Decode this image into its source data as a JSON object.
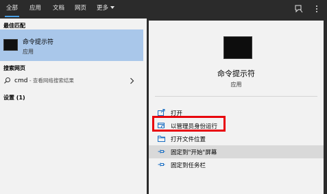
{
  "tabs": [
    {
      "label": "全部",
      "active": true
    },
    {
      "label": "应用",
      "active": false
    },
    {
      "label": "文档",
      "active": false
    },
    {
      "label": "网页",
      "active": false
    },
    {
      "label": "更多",
      "active": false
    }
  ],
  "top_icons": [
    "feedback-icon",
    "more-options-icon"
  ],
  "left": {
    "best_match_heading": "最佳匹配",
    "best_match": {
      "name": "命令提示符",
      "type": "应用",
      "icon": "cmd-icon"
    },
    "web_heading": "搜索网页",
    "web_result": {
      "query": "cmd",
      "hint": " - 查看网络搜索结果"
    },
    "settings_heading": "设置 (1)"
  },
  "right": {
    "app_name": "命令提示符",
    "app_type": "应用",
    "actions": [
      {
        "label": "打开",
        "icon": "open-icon"
      },
      {
        "label": "以管理员身份运行",
        "icon": "run-as-admin-icon"
      },
      {
        "label": "打开文件位置",
        "icon": "folder-icon"
      },
      {
        "label": "固定到\"开始\"屏幕",
        "icon": "pin-icon"
      },
      {
        "label": "固定到任务栏",
        "icon": "pin-icon"
      }
    ]
  },
  "colors": {
    "accent": "#4aa0e6",
    "highlight": "#a9c7ea",
    "annotation": "#e8000b",
    "topbar": "#2b2b2b"
  }
}
